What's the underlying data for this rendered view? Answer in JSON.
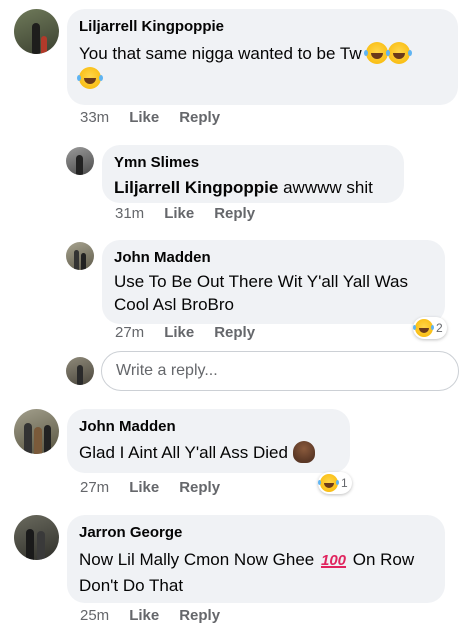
{
  "comments": [
    {
      "name": "Liljarrell Kingpoppie",
      "text": "You that same nigga wanted to be Tw",
      "time": "33m",
      "like": "Like",
      "reply": "Reply"
    },
    {
      "name": "Ymn Slimes",
      "mention": "Liljarrell Kingpoppie",
      "text": " awwww shit",
      "time": "31m",
      "like": "Like",
      "reply": "Reply"
    },
    {
      "name": "John Madden",
      "text": "Use To Be Out There Wit Y'all Yall Was Cool Asl BroBro",
      "time": "27m",
      "like": "Like",
      "reply": "Reply",
      "reaction": {
        "icon": "laughing-emoji",
        "count": "2"
      }
    },
    {
      "name": "John Madden",
      "text": "Glad I Aint All Y'all Ass Died",
      "time": "27m",
      "like": "Like",
      "reply": "Reply",
      "reaction": {
        "icon": "laughing-emoji",
        "count": "1"
      }
    },
    {
      "name": "Jarron George",
      "text_a": "Now Lil Mally Cmon Now Ghee",
      "emoji_100": "100",
      "text_b": "On Row Don't Do That",
      "time": "25m",
      "like": "Like",
      "reply": "Reply"
    }
  ],
  "reply_box": {
    "placeholder": "Write a reply..."
  },
  "icons": [
    "laughing-emoji",
    "person-emoji",
    "hundred-emoji"
  ],
  "colors": {
    "bubble": "#f0f2f5",
    "meta": "#65676b",
    "text": "#050505"
  }
}
